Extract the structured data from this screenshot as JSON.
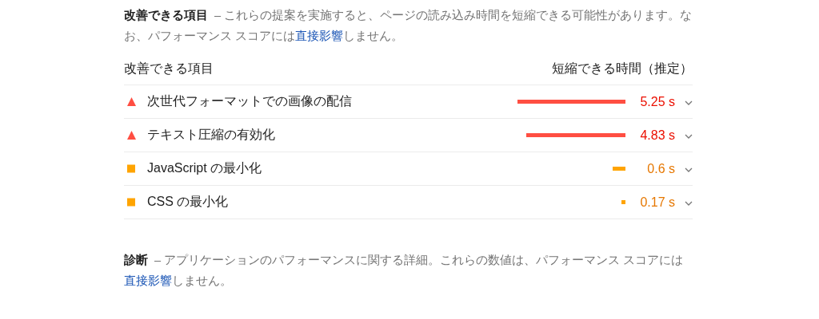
{
  "opportunities": {
    "title": "改善できる項目",
    "description": {
      "before": "– これらの提案を実施すると、ページの読み込み時間を短縮できる可能性があります。なお、パフォーマンス スコアには",
      "link": "直接影響",
      "after": "しません。"
    },
    "columns": [
      "改善できる項目",
      "短縮できる時間（推定）"
    ],
    "rows": [
      {
        "kind": "fail",
        "label": "次世代フォーマットでの画像の配信",
        "savings": "5.25 s",
        "expanded": false
      },
      {
        "kind": "fail",
        "label": "テキスト圧縮の有効化",
        "savings": "4.83 s",
        "expanded": false
      },
      {
        "kind": "average",
        "label": "JavaScript の最小化",
        "savings": "0.6 s",
        "expanded": false
      },
      {
        "kind": "average",
        "label": "CSS の最小化",
        "savings": "0.17 s",
        "expanded": false
      }
    ]
  },
  "diagnostics": {
    "title": "診断",
    "description": {
      "before": "– アプリケーションのパフォーマンスに関する詳細。これらの数値は、パフォーマンス スコアには",
      "link": "直接影響",
      "after": "しません。"
    }
  }
}
